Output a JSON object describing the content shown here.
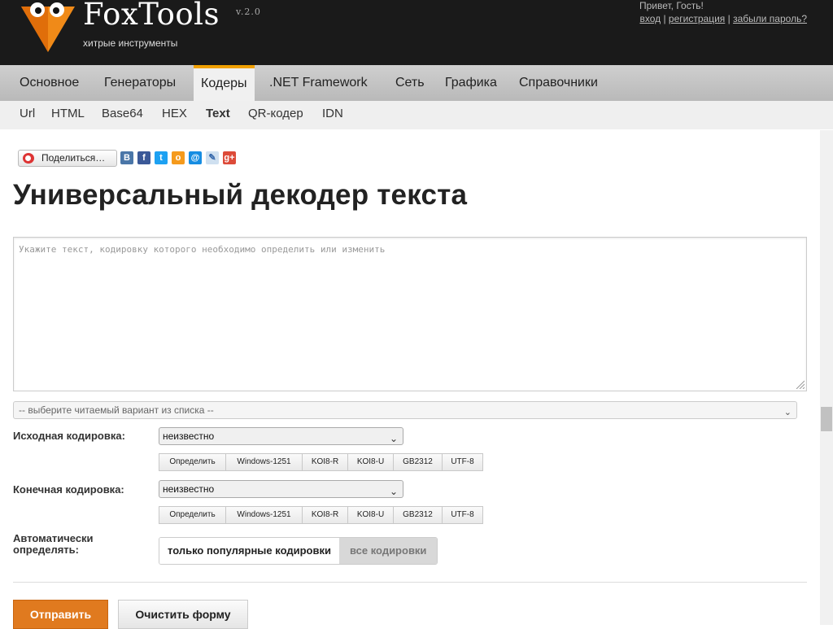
{
  "header": {
    "logo_text": "FoxTools",
    "version": "v.2.0",
    "tagline": "хитрые инструменты",
    "greeting": "Привет, Гость!",
    "auth": {
      "login": "вход",
      "register": "регистрация",
      "forgot": "забыли пароль?",
      "separator": "|"
    }
  },
  "main_nav": {
    "items": [
      {
        "label": "Основное"
      },
      {
        "label": "Генераторы"
      },
      {
        "label": "Кодеры",
        "active": true
      },
      {
        "label": ".NET Framework"
      },
      {
        "label": "Сеть"
      },
      {
        "label": "Графика"
      },
      {
        "label": "Справочники"
      }
    ]
  },
  "sub_nav": {
    "items": [
      {
        "label": "Url"
      },
      {
        "label": "HTML"
      },
      {
        "label": "Base64"
      },
      {
        "label": "HEX"
      },
      {
        "label": "Text",
        "active": true
      },
      {
        "label": "QR-кодер"
      },
      {
        "label": "IDN"
      }
    ]
  },
  "share": {
    "button_label": "Поделиться…",
    "icons": [
      "vkontakte-icon",
      "facebook-icon",
      "twitter-icon",
      "odnoklassniki-icon",
      "mailru-icon",
      "livejournal-icon",
      "googleplus-icon"
    ]
  },
  "page": {
    "title": "Универсальный декодер текста",
    "textarea_placeholder": "Укажите текст, кодировку которого необходимо определить или изменить",
    "variant_select": "-- выберите читаемый вариант из списка --"
  },
  "source": {
    "label": "Исходная кодировка:",
    "selected": "неизвестно",
    "buttons": [
      "Определить",
      "Windows-1251",
      "KOI8-R",
      "KOI8-U",
      "GB2312",
      "UTF-8"
    ]
  },
  "target": {
    "label": "Конечная кодировка:",
    "selected": "неизвестно",
    "buttons": [
      "Определить",
      "Windows-1251",
      "KOI8-R",
      "KOI8-U",
      "GB2312",
      "UTF-8"
    ]
  },
  "auto": {
    "label_line1": "Автоматически",
    "label_line2": "определять:",
    "option_popular": "только популярные кодировки",
    "option_all": "все кодировки"
  },
  "actions": {
    "submit": "Отправить",
    "clear": "Очистить форму"
  },
  "colors": {
    "header_bg": "#1a1a1a",
    "accent_orange": "#e07a1f",
    "nav_active_top": "#f0a000"
  }
}
